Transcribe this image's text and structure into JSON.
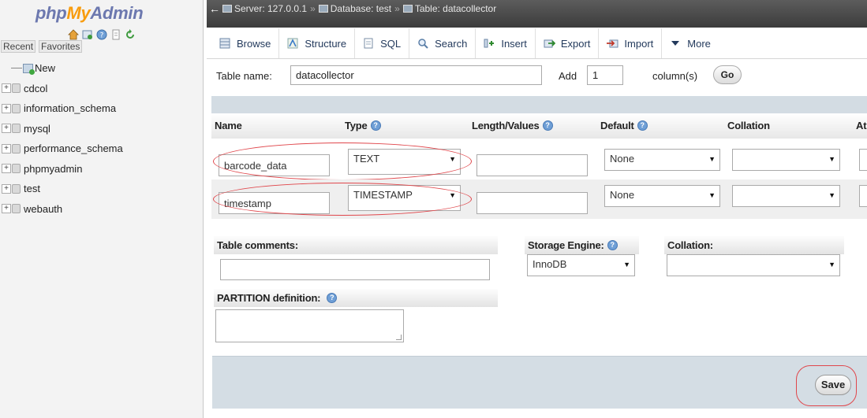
{
  "nav": {
    "logo": {
      "php": "php",
      "my": "My",
      "admin": "Admin"
    },
    "icons": [
      "home-icon",
      "sql-query-icon",
      "help-icon",
      "docs-icon",
      "reload-icon"
    ],
    "recent_label": "Recent",
    "favorites_label": "Favorites",
    "new_label": "New",
    "databases": [
      "cdcol",
      "information_schema",
      "mysql",
      "performance_schema",
      "phpmyadmin",
      "test",
      "webauth"
    ]
  },
  "topbar": {
    "back": "←",
    "server": "Server: 127.0.0.1",
    "database": "Database: test",
    "table": "Table: datacollector",
    "separator": "»"
  },
  "tabs": [
    {
      "label": "Browse",
      "icon": "browse-icon"
    },
    {
      "label": "Structure",
      "icon": "structure-icon"
    },
    {
      "label": "SQL",
      "icon": "sql-icon"
    },
    {
      "label": "Search",
      "icon": "search-icon"
    },
    {
      "label": "Insert",
      "icon": "insert-icon"
    },
    {
      "label": "Export",
      "icon": "export-icon"
    },
    {
      "label": "Import",
      "icon": "import-icon"
    },
    {
      "label": "More",
      "icon": "triangle-down-icon"
    }
  ],
  "table_form": {
    "table_name_label": "Table name:",
    "table_name_value": "datacollector",
    "add_label": "Add",
    "add_value": "1",
    "columns_label": "column(s)",
    "go_label": "Go"
  },
  "columns_header": {
    "name": "Name",
    "type": "Type",
    "length": "Length/Values",
    "default": "Default",
    "collation": "Collation",
    "attributes": "At"
  },
  "rows": [
    {
      "name": "barcode_data",
      "type": "TEXT",
      "length": "",
      "default": "None",
      "collation": ""
    },
    {
      "name": "timestamp",
      "type": "TIMESTAMP",
      "length": "",
      "default": "None",
      "collation": ""
    }
  ],
  "table_options": {
    "comments_label": "Table comments:",
    "comments_value": "",
    "storage_label": "Storage Engine:",
    "storage_value": "InnoDB",
    "collation_label": "Collation:",
    "collation_value": "",
    "partition_label": "PARTITION definition:"
  },
  "footer": {
    "save_label": "Save"
  },
  "colors": {
    "logo_blue": "#6c78af",
    "logo_orange": "#f89c0e",
    "highlight_red": "#e0474c",
    "footer_bg": "#d4dde4"
  }
}
